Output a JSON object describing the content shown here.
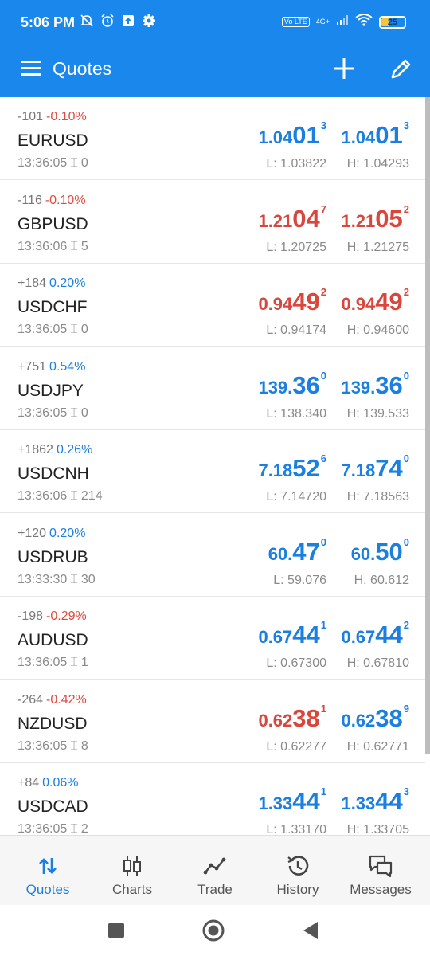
{
  "status_bar": {
    "time": "5:06 PM",
    "network_label": "Vo LTE",
    "network_type": "4G+",
    "battery": "25",
    "icons": [
      "mute-icon",
      "alarm-icon",
      "upload-icon",
      "settings-icon",
      "signal-icon",
      "wifi-icon",
      "battery-icon"
    ]
  },
  "app_bar": {
    "title": "Quotes",
    "icons": [
      "menu-icon",
      "plus-icon",
      "pencil-icon"
    ]
  },
  "colors": {
    "accent": "#1a87ec",
    "up": "#1a7fe0",
    "down": "#d8463c"
  },
  "quotes": [
    {
      "change": "-101",
      "pct": "-0.10%",
      "symbol": "EURUSD",
      "time": "13:36:05",
      "spread": "0",
      "bid": {
        "small": "1.04",
        "big": "01",
        "sup": "3"
      },
      "ask": {
        "small": "1.04",
        "big": "01",
        "sup": "3"
      },
      "low": "L: 1.03822",
      "high": "H: 1.04293",
      "direction": "up"
    },
    {
      "change": "-116",
      "pct": "-0.10%",
      "symbol": "GBPUSD",
      "time": "13:36:06",
      "spread": "5",
      "bid": {
        "small": "1.21",
        "big": "04",
        "sup": "7"
      },
      "ask": {
        "small": "1.21",
        "big": "05",
        "sup": "2"
      },
      "low": "L: 1.20725",
      "high": "H: 1.21275",
      "direction": "down"
    },
    {
      "change": "+184",
      "pct": "0.20%",
      "symbol": "USDCHF",
      "time": "13:36:05",
      "spread": "0",
      "bid": {
        "small": "0.94",
        "big": "49",
        "sup": "2"
      },
      "ask": {
        "small": "0.94",
        "big": "49",
        "sup": "2"
      },
      "low": "L: 0.94174",
      "high": "H: 0.94600",
      "direction": "down"
    },
    {
      "change": "+751",
      "pct": "0.54%",
      "symbol": "USDJPY",
      "time": "13:36:05",
      "spread": "0",
      "bid": {
        "small": "139.",
        "big": "36",
        "sup": "0"
      },
      "ask": {
        "small": "139.",
        "big": "36",
        "sup": "0"
      },
      "low": "L: 138.340",
      "high": "H: 139.533",
      "direction": "up"
    },
    {
      "change": "+1862",
      "pct": "0.26%",
      "symbol": "USDCNH",
      "time": "13:36:06",
      "spread": "214",
      "bid": {
        "small": "7.18",
        "big": "52",
        "sup": "6"
      },
      "ask": {
        "small": "7.18",
        "big": "74",
        "sup": "0"
      },
      "low": "L: 7.14720",
      "high": "H: 7.18563",
      "direction": "up"
    },
    {
      "change": "+120",
      "pct": "0.20%",
      "symbol": "USDRUB",
      "time": "13:33:30",
      "spread": "30",
      "bid": {
        "small": "60.",
        "big": "47",
        "sup": "0"
      },
      "ask": {
        "small": "60.",
        "big": "50",
        "sup": "0"
      },
      "low": "L: 59.076",
      "high": "H: 60.612",
      "direction": "up"
    },
    {
      "change": "-198",
      "pct": "-0.29%",
      "symbol": "AUDUSD",
      "time": "13:36:05",
      "spread": "1",
      "bid": {
        "small": "0.67",
        "big": "44",
        "sup": "1"
      },
      "ask": {
        "small": "0.67",
        "big": "44",
        "sup": "2"
      },
      "low": "L: 0.67300",
      "high": "H: 0.67810",
      "direction": "up"
    },
    {
      "change": "-264",
      "pct": "-0.42%",
      "symbol": "NZDUSD",
      "time": "13:36:05",
      "spread": "8",
      "bid": {
        "small": "0.62",
        "big": "38",
        "sup": "1"
      },
      "ask": {
        "small": "0.62",
        "big": "38",
        "sup": "9"
      },
      "low": "L: 0.62277",
      "high": "H: 0.62771",
      "direction": "mixed"
    },
    {
      "change": "+84",
      "pct": "0.06%",
      "symbol": "USDCAD",
      "time": "13:36:05",
      "spread": "2",
      "bid": {
        "small": "1.33",
        "big": "44",
        "sup": "1"
      },
      "ask": {
        "small": "1.33",
        "big": "44",
        "sup": "3"
      },
      "low": "L: 1.33170",
      "high": "H: 1.33705",
      "direction": "up"
    }
  ],
  "bottom_nav": [
    {
      "label": "Quotes",
      "icon": "quotes-icon",
      "active": true
    },
    {
      "label": "Charts",
      "icon": "charts-icon",
      "active": false
    },
    {
      "label": "Trade",
      "icon": "trade-icon",
      "active": false
    },
    {
      "label": "History",
      "icon": "history-icon",
      "active": false
    },
    {
      "label": "Messages",
      "icon": "messages-icon",
      "active": false
    }
  ],
  "system_nav": [
    "recents-button",
    "home-button",
    "back-button"
  ]
}
